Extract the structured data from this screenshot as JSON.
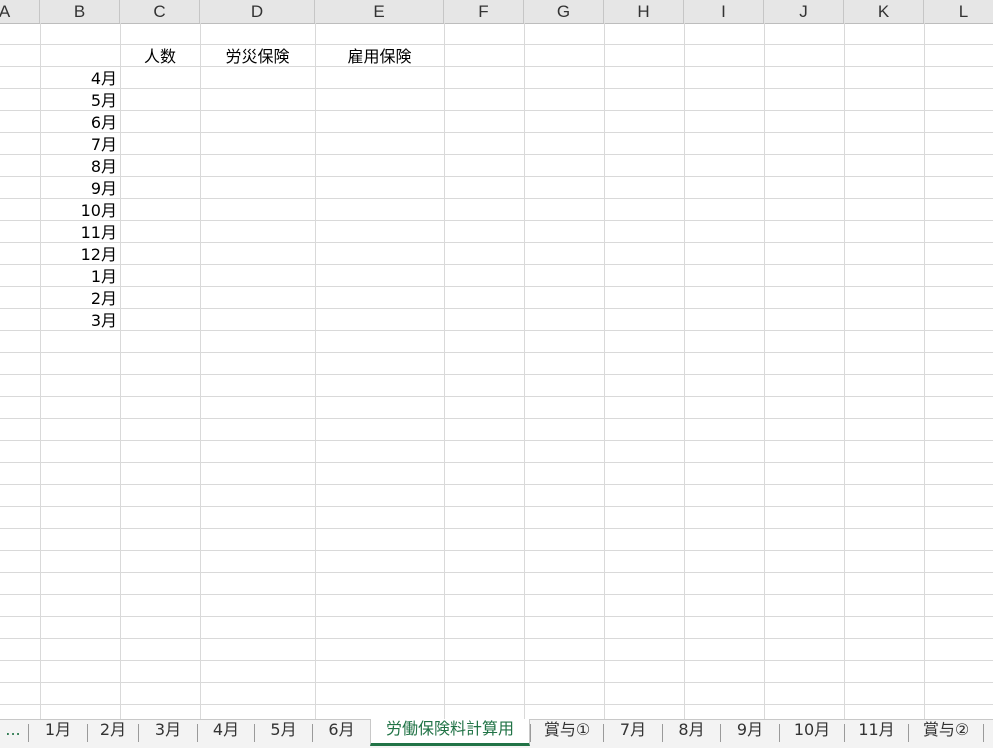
{
  "columns": [
    "A",
    "B",
    "C",
    "D",
    "E",
    "F",
    "G",
    "H",
    "I",
    "J",
    "K",
    "L"
  ],
  "headers": {
    "c": "人数",
    "d": "労災保険",
    "e": "雇用保険"
  },
  "months": [
    "4月",
    "5月",
    "6月",
    "7月",
    "8月",
    "9月",
    "10月",
    "11月",
    "12月",
    "1月",
    "2月",
    "3月"
  ],
  "sheet_tabs": {
    "overflow": "...",
    "tabs": [
      "1月",
      "2月",
      "3月",
      "4月",
      "5月",
      "6月",
      "労働保険料計算用",
      "賞与①",
      "7月",
      "8月",
      "9月",
      "10月",
      "11月",
      "賞与②"
    ],
    "active": "労働保険料計算用"
  }
}
